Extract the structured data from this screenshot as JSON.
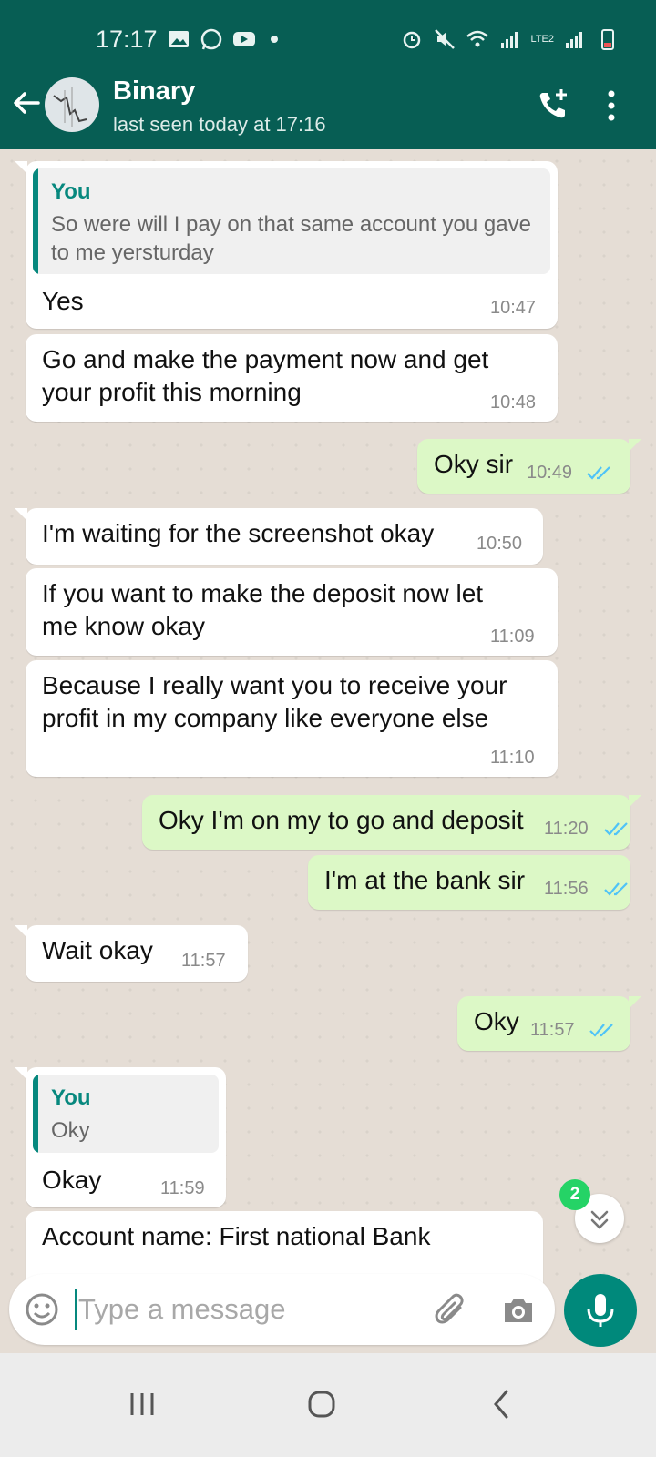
{
  "status_bar": {
    "time": "17:17",
    "network_label": "LTE2"
  },
  "header": {
    "contact_name": "Binary",
    "last_seen": "last seen today at 17:16"
  },
  "messages": [
    {
      "dir": "in",
      "quote_author": "You",
      "quote_text": "So were will I pay on that same account you gave to me yersturday",
      "text": "Yes",
      "time": "10:47"
    },
    {
      "dir": "in",
      "text": "Go and make the payment now and get\nyour profit this morning",
      "time": "10:48"
    },
    {
      "dir": "out",
      "text": "Oky sir",
      "time": "10:49"
    },
    {
      "dir": "in",
      "text": "I'm waiting for the screenshot okay",
      "time": "10:50"
    },
    {
      "dir": "in",
      "text": "If you want to make the deposit now let\nme know okay",
      "time": "11:09"
    },
    {
      "dir": "in",
      "text": "Because I really want you to receive your\nprofit in my company like everyone else",
      "time": "11:10"
    },
    {
      "dir": "out",
      "text": "Oky I'm on my to go and deposit",
      "time": "11:20"
    },
    {
      "dir": "out",
      "text": "I'm at the bank sir",
      "time": "11:56"
    },
    {
      "dir": "in",
      "text": "Wait okay",
      "time": "11:57"
    },
    {
      "dir": "out",
      "text": "Oky",
      "time": "11:57"
    },
    {
      "dir": "in",
      "quote_author": "You",
      "quote_text": "Oky",
      "text": "Okay",
      "time": "11:59"
    },
    {
      "dir": "in",
      "text": "Account name: First national Bank",
      "time": ""
    }
  ],
  "scroll_down": {
    "unread_count": "2"
  },
  "composer": {
    "placeholder": "Type a message"
  },
  "colors": {
    "header": "#075e54",
    "outgoing_bubble": "#dcf8c6",
    "accent": "#00897b",
    "badge": "#25d366",
    "read_ticks": "#4fc3f7"
  },
  "icons": [
    "back-arrow-icon",
    "add-call-icon",
    "more-options-icon",
    "emoji-icon",
    "attach-icon",
    "camera-icon",
    "mic-icon",
    "chevron-double-down-icon",
    "recents-icon",
    "home-icon",
    "nav-back-icon"
  ]
}
